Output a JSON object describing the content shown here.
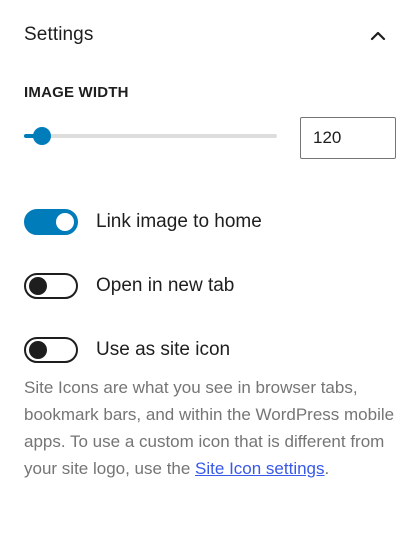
{
  "panel": {
    "title": "Settings",
    "collapse_icon": "chevron-up-icon"
  },
  "image_width": {
    "label": "IMAGE WIDTH",
    "value": "120",
    "slider_fraction": 0.07
  },
  "toggles": {
    "link_home": {
      "label": "Link image to home",
      "checked": true
    },
    "new_tab": {
      "label": "Open in new tab",
      "checked": false
    },
    "site_icon": {
      "label": "Use as site icon",
      "checked": false
    }
  },
  "help": {
    "text": "Site Icons are what you see in browser tabs, bookmark bars, and within the WordPress mobile apps. To use a custom icon that is different from your site logo, use the ",
    "link_text": "Site Icon settings",
    "suffix": "."
  },
  "colors": {
    "accent": "#007cba",
    "link": "#3858e9",
    "text": "#1e1e1e",
    "muted": "#757575"
  }
}
